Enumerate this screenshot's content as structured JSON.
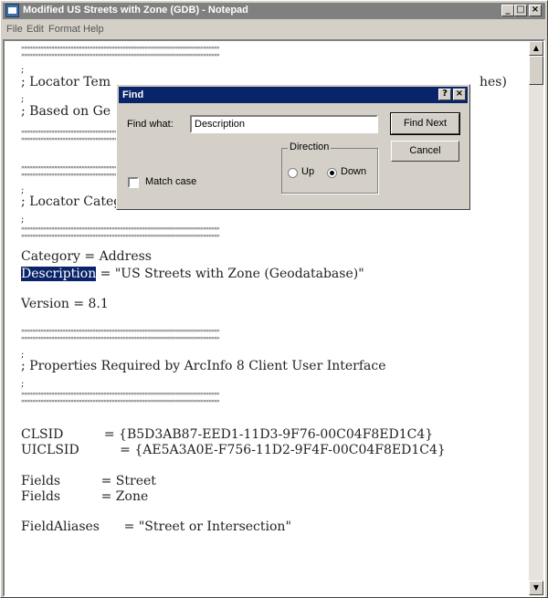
{
  "window": {
    "title": "Modified US Streets with Zone (GDB) - Notepad",
    "minimize_glyph": "_",
    "maximize_glyph": "□",
    "close_glyph": "×"
  },
  "menu": {
    "file": "File",
    "edit": "Edit",
    "format": "Format",
    "help": "Help"
  },
  "content": {
    "dots": "»»»»»»»»»»»»»»»»»»»»»»»»»»»»»»»»»»»»»»»»»»»»»»»»»»»»»»»»»»»»»»»»»»»»»»»»",
    "semicolon": ";",
    "locator_template_start": "; Locator Tem",
    "locator_template_end": "hes)",
    "based_on_start": "; Based on Ge",
    "locator_category": "; Locator Category",
    "category_line": "Category = Address",
    "description_key": "Description",
    "description_value": " = \"US Streets with Zone (Geodatabase)\"",
    "version_line": "Version = 8.1",
    "properties_line": "; Properties Required by ArcInfo 8 Client User Interface",
    "clsid_line": "CLSID          = {B5D3AB87-EED1-11D3-9F76-00C04F8ED1C4}",
    "uiclsid_line": "UICLSID          = {AE5A3A0E-F756-11D2-9F4F-00C04F8ED1C4}",
    "fields_street": "Fields          = Street",
    "fields_zone": "Fields          = Zone",
    "field_aliases": "FieldAliases      = \"Street or Intersection\""
  },
  "find_dialog": {
    "title": "Find",
    "help_glyph": "?",
    "close_glyph": "×",
    "find_what_label": "Find what:",
    "find_what_value": "Description",
    "find_next_label": "Find Next",
    "cancel_label": "Cancel",
    "direction_label": "Direction",
    "up_label": "Up",
    "down_label": "Down",
    "direction_selected": "Down",
    "match_case_label": "Match case",
    "match_case_checked": false
  },
  "scrollbar": {
    "up_glyph": "▲",
    "down_glyph": "▼"
  }
}
